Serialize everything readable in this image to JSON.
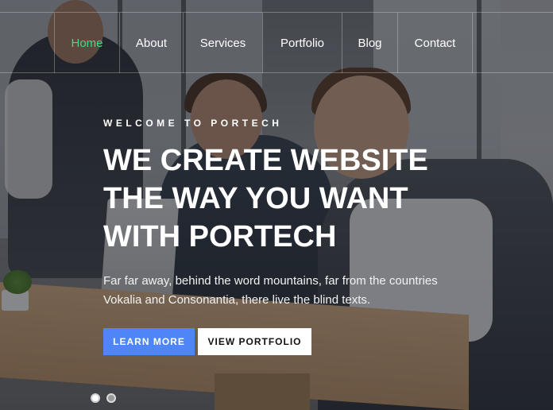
{
  "nav": {
    "items": [
      {
        "label": "Home",
        "active": true
      },
      {
        "label": "About",
        "active": false
      },
      {
        "label": "Services",
        "active": false
      },
      {
        "label": "Portfolio",
        "active": false
      },
      {
        "label": "Blog",
        "active": false
      },
      {
        "label": "Contact",
        "active": false
      }
    ],
    "active_color": "#3ddc84"
  },
  "hero": {
    "eyebrow": "WELCOME TO PORTECH",
    "headline_lines": [
      "WE CREATE WEBSITE",
      "THE WAY YOU WANT",
      "WITH PORTECH"
    ],
    "lead_lines": [
      "Far far away, behind the word mountains, far from the countries",
      "Vokalia and Consonantia, there live the blind texts."
    ],
    "primary_button": "LEARN MORE",
    "secondary_button": "VIEW PORTFOLIO",
    "primary_color": "#4f86f7"
  },
  "carousel": {
    "slide_count": 2,
    "active_slide": 1
  }
}
